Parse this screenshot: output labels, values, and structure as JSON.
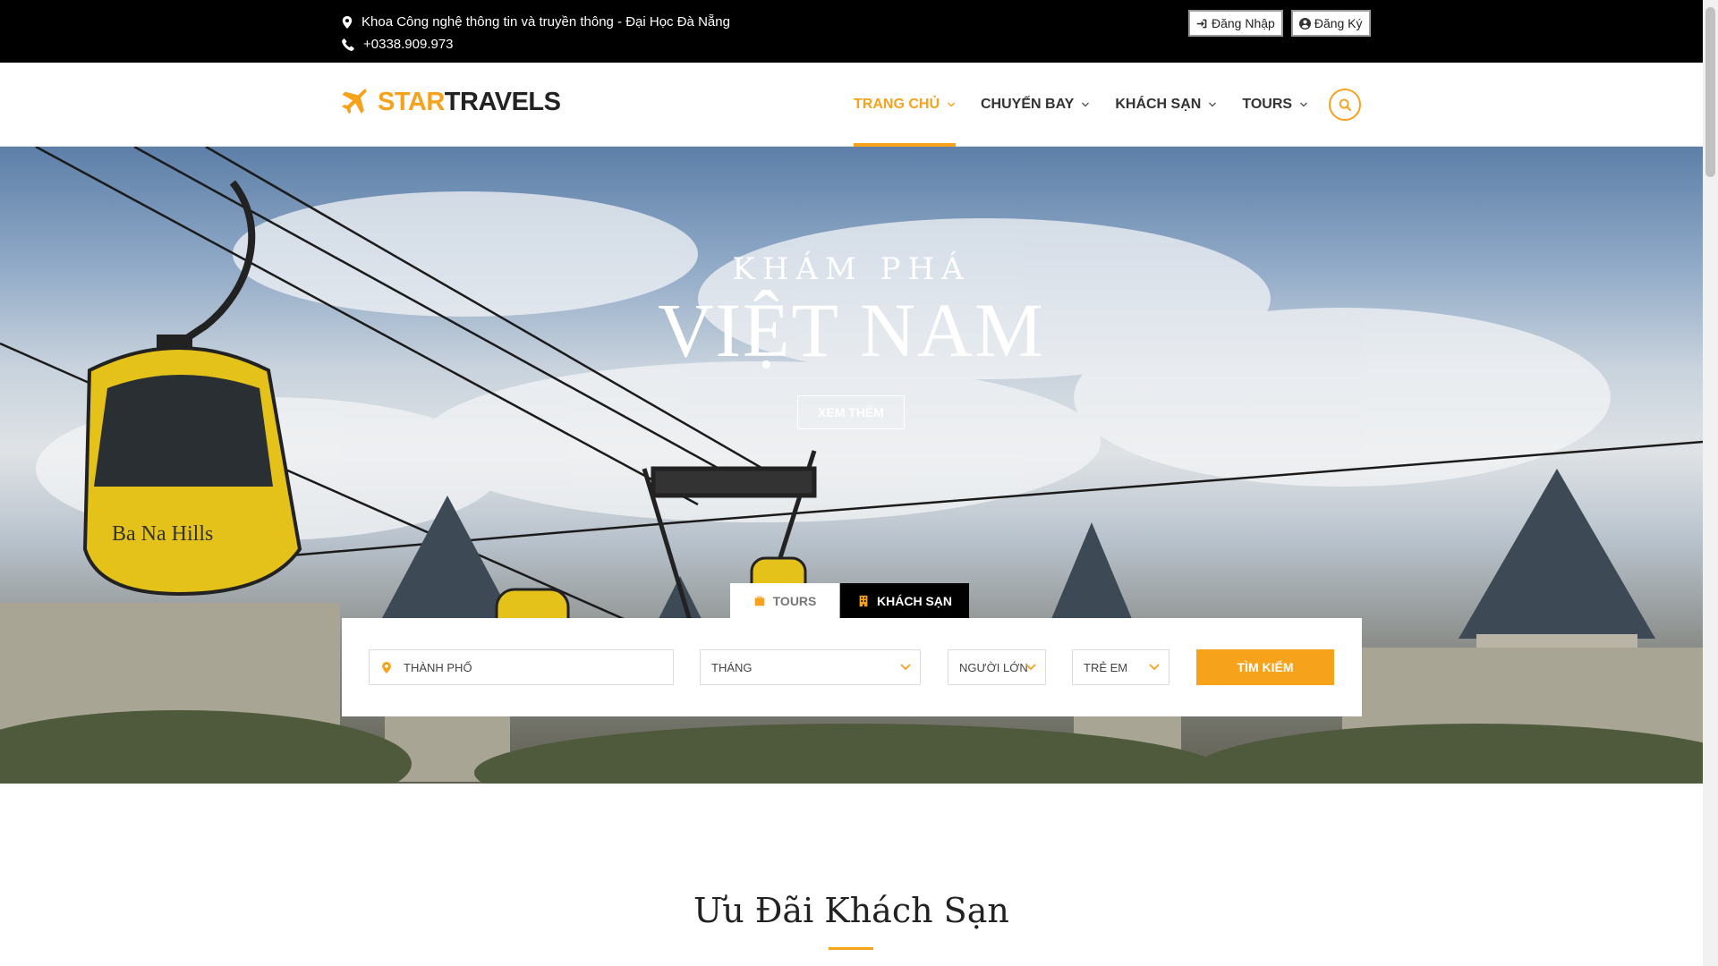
{
  "topbar": {
    "address": "Khoa Công nghệ thông tin và truyền thông - Đại Học Đà Nẵng",
    "phone": "+0338.909.973",
    "login_label": "Đăng Nhập",
    "register_label": "Đăng Ký"
  },
  "brand": {
    "part1": "STAR",
    "part2": "TRAVELS"
  },
  "nav": {
    "items": [
      {
        "label": "TRANG CHỦ",
        "active": true
      },
      {
        "label": "CHUYẾN BAY",
        "active": false
      },
      {
        "label": "KHÁCH SẠN",
        "active": false
      },
      {
        "label": "TOURS",
        "active": false
      }
    ]
  },
  "hero": {
    "subtitle": "KHÁM PHÁ",
    "title": "VIỆT NAM",
    "button_label": "XEM THÊM",
    "cabin_text": "Ba Na Hills"
  },
  "search": {
    "tabs": [
      {
        "label": "TOURS",
        "icon": "suitcase-icon"
      },
      {
        "label": "KHÁCH SẠN",
        "icon": "building-icon"
      }
    ],
    "city_placeholder": "THÀNH PHỐ",
    "month_label": "THÁNG",
    "adults_label": "NGƯỜI LỚN",
    "children_label": "TRẺ EM",
    "submit_label": "TÌM KIẾM"
  },
  "section": {
    "title": "Ưu Đãi Khách Sạn"
  },
  "colors": {
    "accent": "#f7a21b",
    "topbar": "#000000",
    "text": "#333333"
  }
}
